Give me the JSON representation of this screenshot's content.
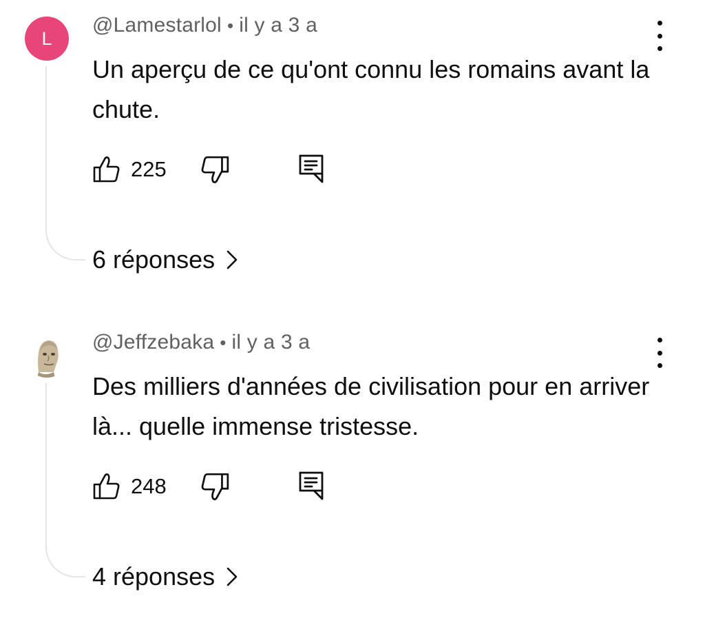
{
  "comments": [
    {
      "avatar": {
        "type": "letter",
        "letter": "L",
        "color": "#e8457a"
      },
      "author": "@Lamestarlol",
      "separator": "•",
      "time": "il y a 3 a",
      "text": "Un aperçu de ce qu'ont connu les romains avant la chute.",
      "likes": "225",
      "replies_label": "6 réponses"
    },
    {
      "avatar": {
        "type": "image",
        "icon": "meme-man-avatar"
      },
      "author": "@Jeffzebaka",
      "separator": "•",
      "time": "il y a 3 a",
      "text": "Des milliers d'années de civilisation pour en arriver là... quelle immense tristesse.",
      "likes": "248",
      "replies_label": "4 réponses"
    }
  ],
  "icons": {
    "like": "thumbs-up-icon",
    "dislike": "thumbs-down-icon",
    "reply": "comment-reply-icon",
    "more": "more-vertical-icon",
    "chevron": "chevron-right-icon"
  },
  "colors": {
    "text_primary": "#0f0f0f",
    "text_secondary": "#606060",
    "thread_line": "#e5e5e5"
  }
}
